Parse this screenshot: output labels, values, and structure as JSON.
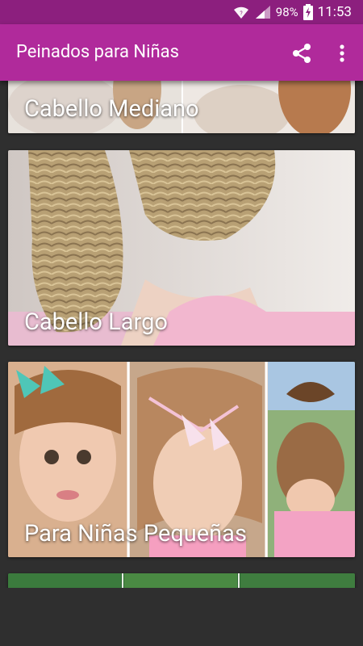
{
  "status": {
    "battery_pct": "98%",
    "time": "11:53"
  },
  "appbar": {
    "title": "Peinados para Niñas"
  },
  "cards": [
    {
      "label": "Cabello Mediano"
    },
    {
      "label": "Cabello Largo"
    },
    {
      "label": "Para Niñas Pequeñas"
    },
    {
      "label": ""
    }
  ],
  "colors": {
    "status_bar": "#8c1f7e",
    "app_bar": "#b02a9b",
    "background": "#2f2f2f"
  }
}
